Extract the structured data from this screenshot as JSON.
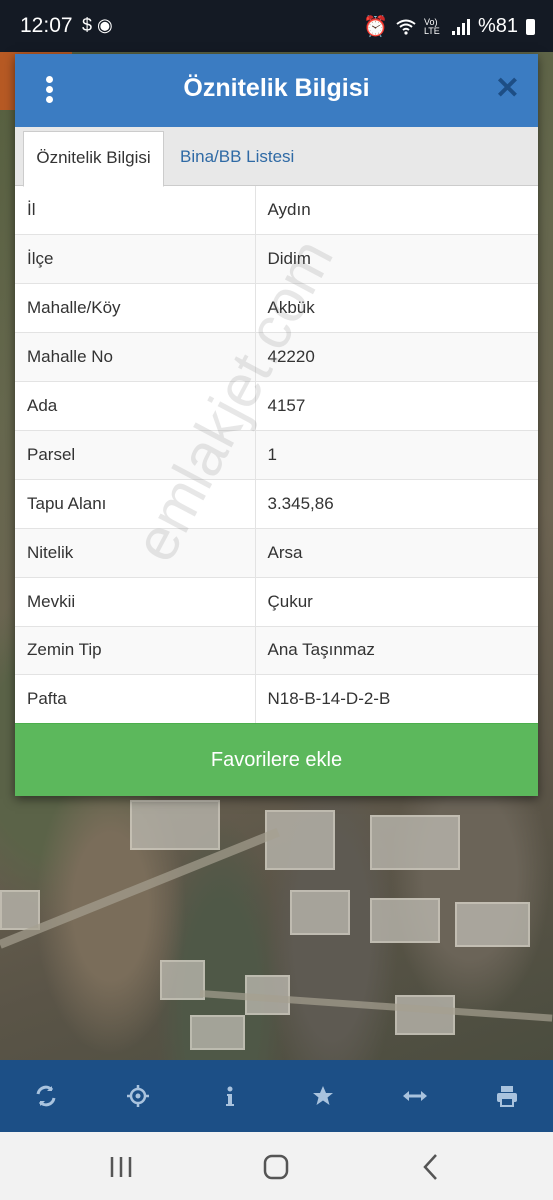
{
  "status_bar": {
    "time": "12:07",
    "left_icons": "$ ◉",
    "battery": "%81",
    "network": "Vo) LTE"
  },
  "dialog": {
    "title": "Öznitelik Bilgisi",
    "tabs": [
      "Öznitelik Bilgisi",
      "Bina/BB Listesi"
    ],
    "rows": [
      {
        "label": "İl",
        "value": "Aydın"
      },
      {
        "label": "İlçe",
        "value": "Didim"
      },
      {
        "label": "Mahalle/Köy",
        "value": "Akbük"
      },
      {
        "label": "Mahalle No",
        "value": "42220"
      },
      {
        "label": "Ada",
        "value": "4157"
      },
      {
        "label": "Parsel",
        "value": "1"
      },
      {
        "label": "Tapu Alanı",
        "value": "3.345,86"
      },
      {
        "label": "Nitelik",
        "value": "Arsa"
      },
      {
        "label": "Mevkii",
        "value": "Çukur"
      },
      {
        "label": "Zemin Tip",
        "value": "Ana Taşınmaz"
      },
      {
        "label": "Pafta",
        "value": "N18-B-14-D-2-B"
      }
    ],
    "favorite_button": "Favorilere ekle"
  },
  "watermark": "emlakjet.com",
  "toolbar": {
    "icons": [
      "refresh-icon",
      "locate-icon",
      "info-icon",
      "star-icon",
      "measure-icon",
      "print-icon"
    ]
  },
  "nav": {
    "icons": [
      "recents-icon",
      "home-icon",
      "back-icon"
    ]
  },
  "colors": {
    "header": "#3b7cc2",
    "toolbar": "#1c4f86",
    "favorite": "#5cb85c"
  }
}
